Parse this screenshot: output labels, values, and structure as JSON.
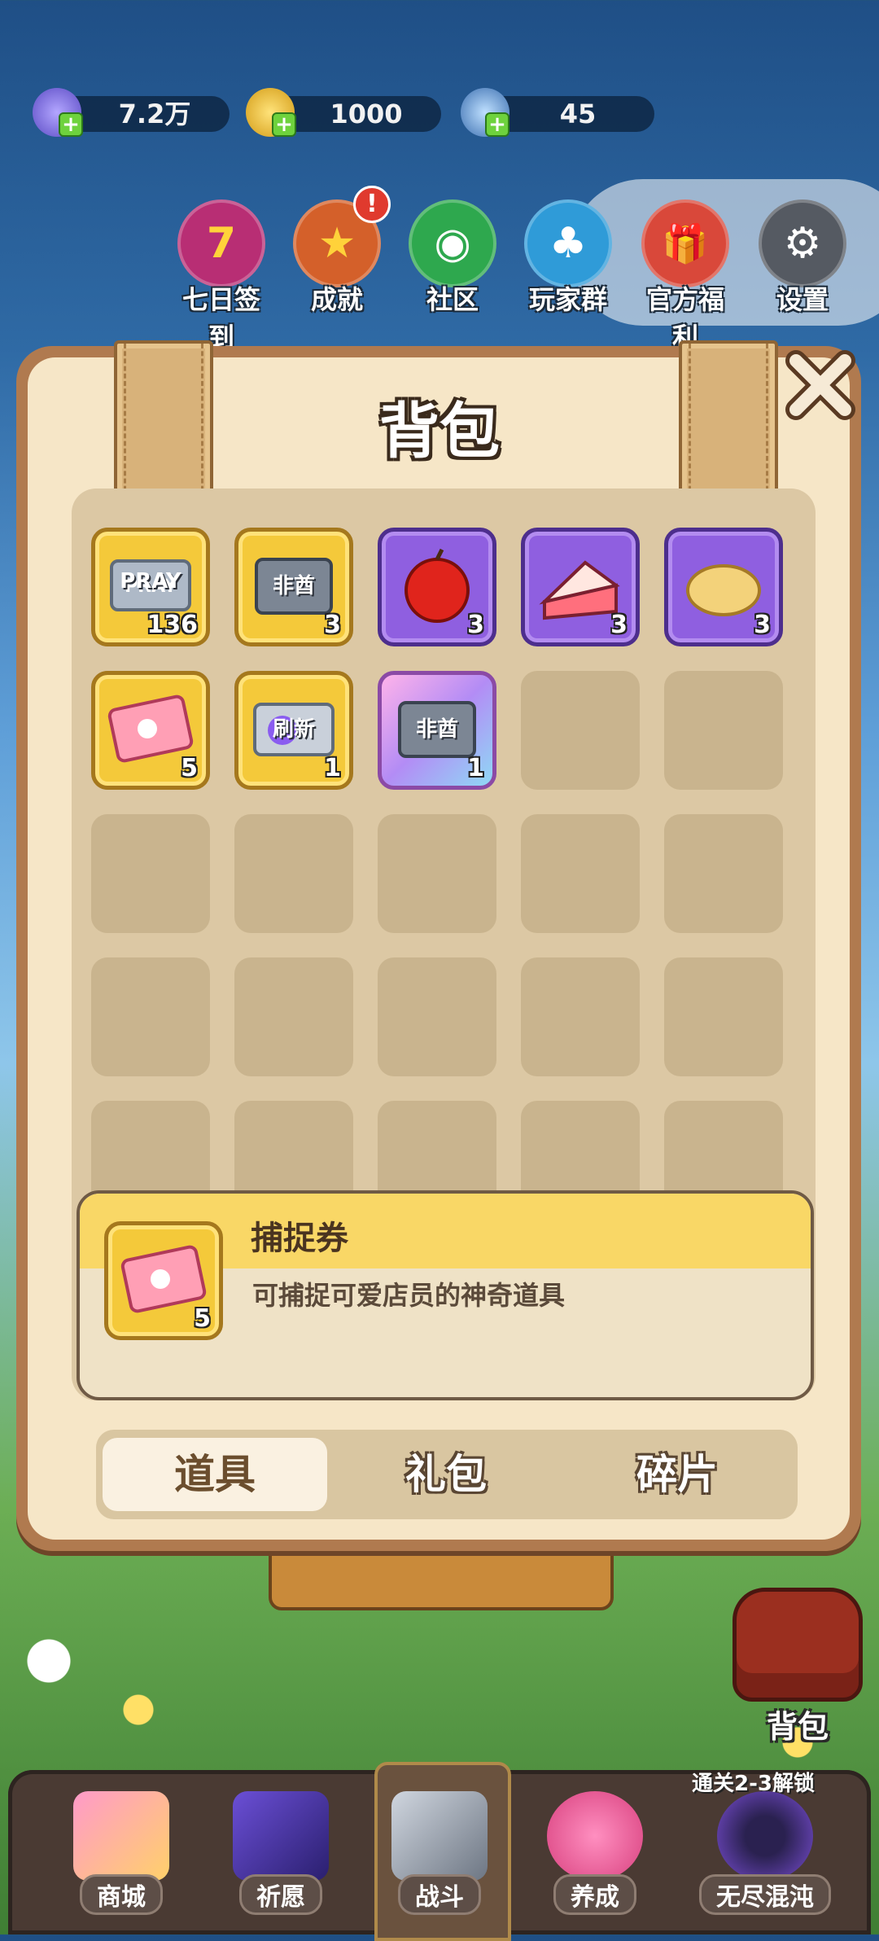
{
  "resources": [
    {
      "icon": "gem-icon",
      "value": "7.2万"
    },
    {
      "icon": "coin-icon",
      "value": "1000"
    },
    {
      "icon": "energy-icon",
      "value": "45"
    }
  ],
  "top_menu": [
    {
      "icon": "calendar-seven-icon",
      "glyph": "7",
      "label": "七日签到"
    },
    {
      "icon": "trophy-icon",
      "glyph": "★",
      "label": "成就",
      "badge": "!"
    },
    {
      "icon": "chat-icon",
      "glyph": "◉",
      "label": "社区"
    },
    {
      "icon": "penguin-icon",
      "glyph": "♣",
      "label": "玩家群"
    },
    {
      "icon": "gift-icon",
      "glyph": "🎁",
      "label": "官方福利"
    },
    {
      "icon": "gear-icon",
      "glyph": "⚙",
      "label": "设置"
    }
  ],
  "backpack": {
    "title": "背包",
    "items": [
      {
        "name": "pray-ticket",
        "rarity": "gold",
        "count": "136",
        "text": "PRAY"
      },
      {
        "name": "non-chief-ticket",
        "rarity": "gold",
        "count": "3",
        "text": "非酋"
      },
      {
        "name": "apple",
        "rarity": "purple",
        "count": "3",
        "text": ""
      },
      {
        "name": "cake",
        "rarity": "purple",
        "count": "3",
        "text": ""
      },
      {
        "name": "chips",
        "rarity": "purple",
        "count": "3",
        "text": ""
      },
      {
        "name": "capture-ticket",
        "rarity": "gold",
        "count": "5",
        "text": ""
      },
      {
        "name": "refresh-ticket",
        "rarity": "gold",
        "count": "1",
        "text": "刷新"
      },
      {
        "name": "non-chief-ticket-rare",
        "rarity": "pink",
        "count": "1",
        "text": "非酋"
      }
    ],
    "selected": {
      "name": "捕捉券",
      "description": "可捕捉可爱店员的神奇道具",
      "count": "5"
    },
    "tabs": [
      "道具",
      "礼包",
      "碎片"
    ],
    "active_tab": "道具"
  },
  "side_button": {
    "label": "背包"
  },
  "unlock_hint": "通关2-3解锁",
  "bottom_nav": [
    {
      "icon": "shop-icon",
      "label": "商城"
    },
    {
      "icon": "card-icon",
      "label": "祈愿"
    },
    {
      "icon": "swords-icon",
      "label": "战斗"
    },
    {
      "icon": "paw-icon",
      "label": "养成"
    },
    {
      "icon": "lock-icon",
      "label": "无尽混沌"
    }
  ]
}
